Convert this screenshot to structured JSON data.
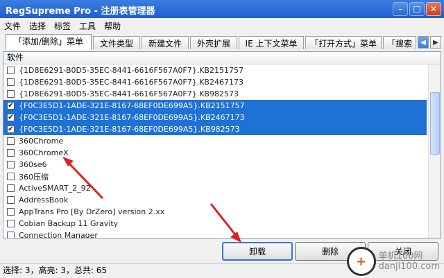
{
  "window": {
    "title": "RegSupreme Pro - 注册表管理器"
  },
  "menubar": [
    "文件",
    "选择",
    "标签",
    "工具",
    "帮助"
  ],
  "tabs": [
    "「添加/删除」菜单",
    "文件类型",
    "新建文件",
    "外壳扩展",
    "IE 上下文菜单",
    "「打开方式」菜单",
    "「搜索"
  ],
  "list": {
    "header": "软件",
    "rows": [
      {
        "label": "{1D8E6291-B0D5-35EC-8441-6616F567A0F7}.KB2151757",
        "checked": false,
        "selected": false
      },
      {
        "label": "{1D8E6291-B0D5-35EC-8441-6616F567A0F7}.KB2467173",
        "checked": false,
        "selected": false
      },
      {
        "label": "{1D8E6291-B0D5-35EC-8441-6616F567A0F7}.KB982573",
        "checked": false,
        "selected": false
      },
      {
        "label": "{F0C3E5D1-1ADE-321E-8167-68EF0DE699A5}.KB2151757",
        "checked": true,
        "selected": true
      },
      {
        "label": "{F0C3E5D1-1ADE-321E-8167-68EF0DE699A5}.KB2467173",
        "checked": true,
        "selected": true
      },
      {
        "label": "{F0C3E5D1-1ADE-321E-8167-68EF0DE699A5}.KB982573",
        "checked": true,
        "selected": true
      },
      {
        "label": "360Chrome",
        "checked": false,
        "selected": false
      },
      {
        "label": "360ChromeX",
        "checked": false,
        "selected": false
      },
      {
        "label": "360se6",
        "checked": false,
        "selected": false
      },
      {
        "label": "360压缩",
        "checked": false,
        "selected": false
      },
      {
        "label": "ActiveSMART_2_92",
        "checked": false,
        "selected": false
      },
      {
        "label": "AddressBook",
        "checked": false,
        "selected": false
      },
      {
        "label": "AppTrans Pro [By DrZero] version 2.xx",
        "checked": false,
        "selected": false
      },
      {
        "label": "Cobian Backup 11 Gravity",
        "checked": false,
        "selected": false
      },
      {
        "label": "Connection Manager",
        "checked": false,
        "selected": false
      }
    ]
  },
  "buttons": {
    "uninstall": "卸载",
    "delete": "删除",
    "close": "关闭"
  },
  "status": "选择: 3，高亮: 3，总共: 65",
  "watermark": {
    "site_name": "单机100网",
    "site_url": "danji100.com"
  },
  "colors": {
    "selection": "#1e72d6",
    "annotation_arrow": "#e02020",
    "titlebar": "#2a67d4"
  }
}
